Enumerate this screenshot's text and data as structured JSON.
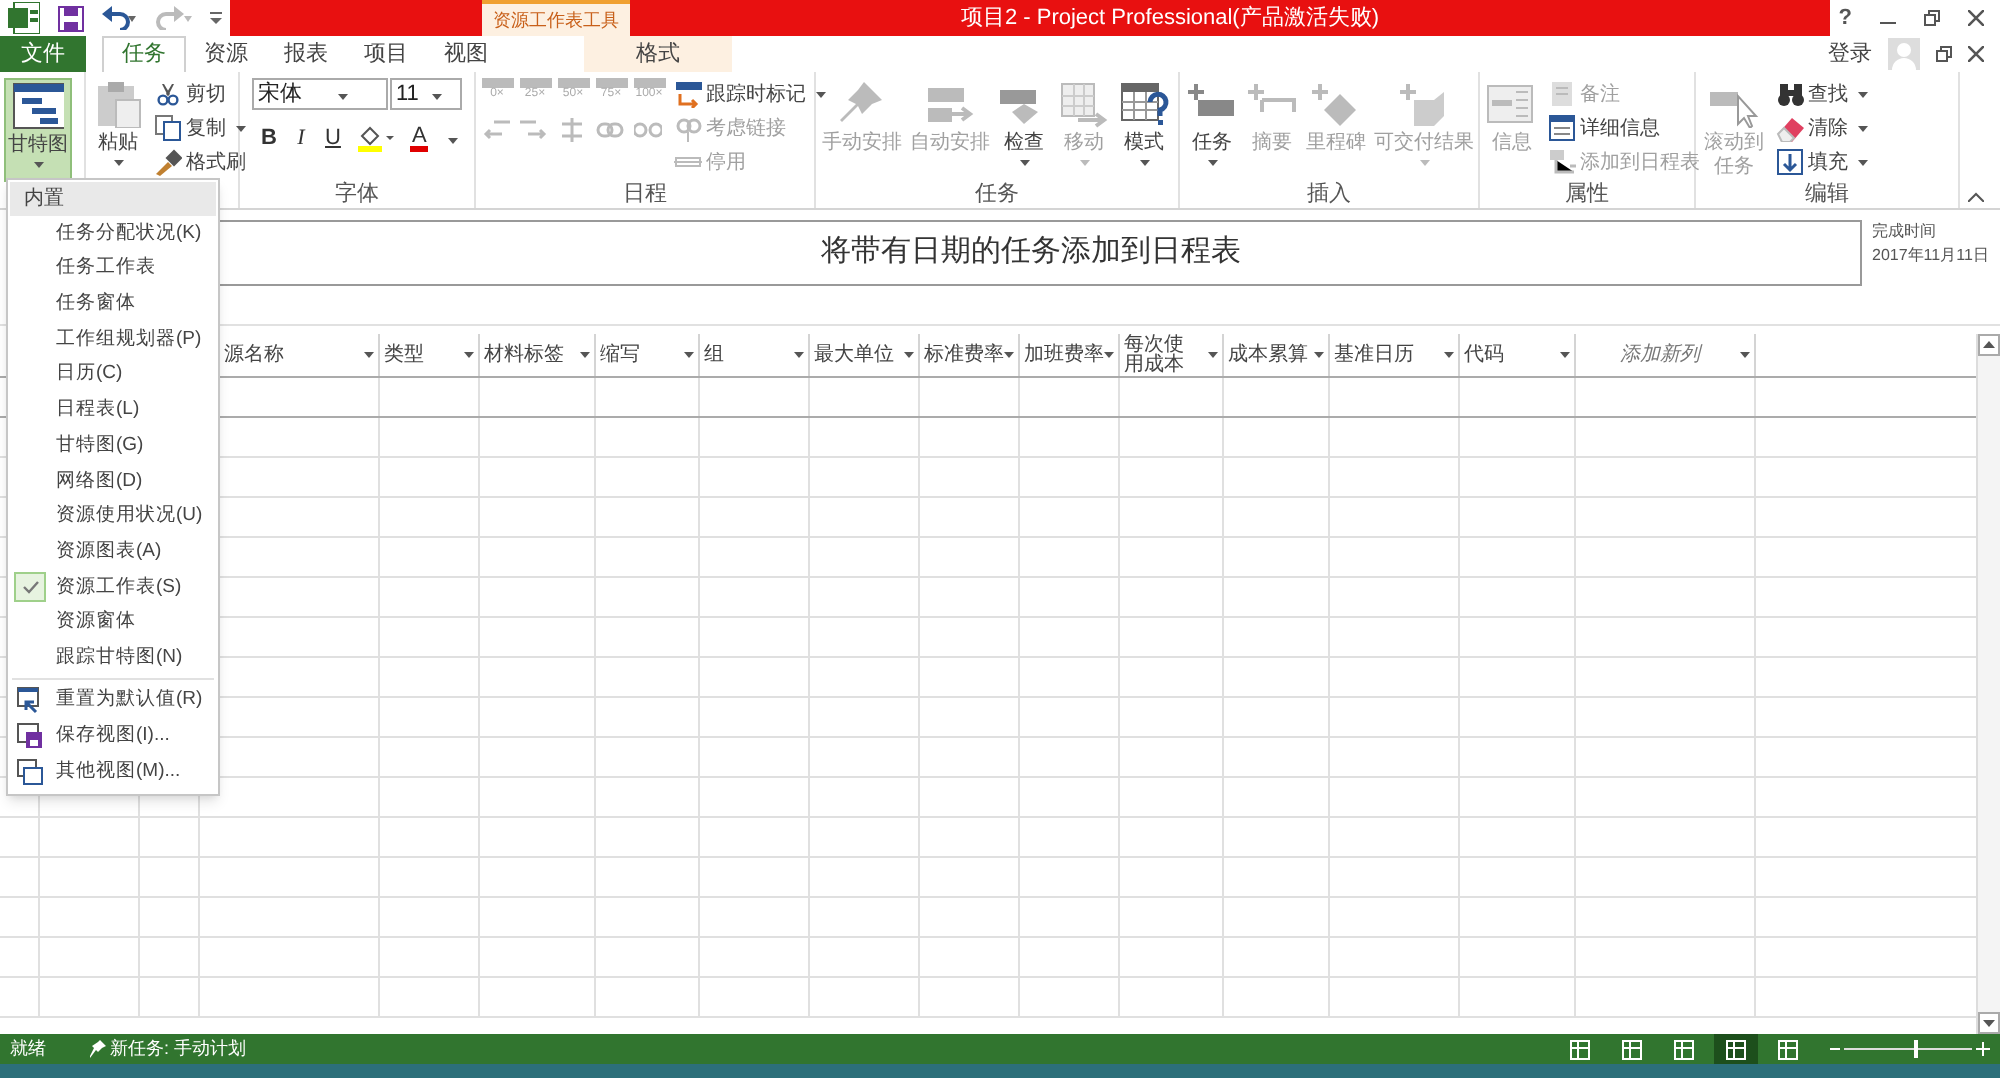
{
  "title_bar": {
    "context_label": "资源工作表工具",
    "title": "项目2 -  Project Professional(产品激活失败)",
    "help": "?"
  },
  "tabs": [
    {
      "label": "文件",
      "kind": "file",
      "selected": false
    },
    {
      "label": "任务",
      "kind": "tab",
      "selected": true
    },
    {
      "label": "资源",
      "kind": "tab",
      "selected": false
    },
    {
      "label": "报表",
      "kind": "tab",
      "selected": false
    },
    {
      "label": "项目",
      "kind": "tab",
      "selected": false
    },
    {
      "label": "视图",
      "kind": "tab",
      "selected": false
    },
    {
      "label": "格式",
      "kind": "context",
      "selected": false
    }
  ],
  "account": {
    "sign_in": "登录"
  },
  "ribbon": {
    "groups": [
      {
        "items": [
          {
            "kind": "large",
            "label": "甘特图",
            "caret": true,
            "selected": true,
            "disabled": false
          }
        ]
      },
      {
        "items": [
          {
            "kind": "large",
            "label": "粘贴",
            "caret": true,
            "selected": false,
            "disabled": false
          },
          {
            "kind": "stack",
            "items": [
              {
                "label": "剪切",
                "caret": false,
                "disabled": false
              },
              {
                "label": "复制",
                "caret": true,
                "disabled": false
              },
              {
                "label": "格式刷",
                "caret": false,
                "disabled": false
              }
            ]
          }
        ]
      },
      {
        "label": "字体",
        "items": [
          {
            "kind": "font",
            "font_name": "宋体",
            "font_size": "11",
            "styles": [
              "B",
              "I",
              "U"
            ],
            "font_color_glyph": "A"
          }
        ]
      },
      {
        "label": "日程",
        "items": [
          {
            "kind": "percent",
            "labels": [
              "0×",
              "25×",
              "50×",
              "75×",
              "100×"
            ]
          },
          {
            "kind": "stack",
            "items": [
              {
                "label": "跟踪时标记",
                "caret": true,
                "disabled": false
              },
              {
                "label": "考虑链接",
                "caret": false,
                "disabled": true
              },
              {
                "label": "停用",
                "caret": false,
                "disabled": true
              }
            ]
          }
        ]
      },
      {
        "label": "任务",
        "items": [
          {
            "kind": "large",
            "label": "手动安排",
            "caret": false,
            "selected": false,
            "disabled": true
          },
          {
            "kind": "large",
            "label": "自动安排",
            "caret": false,
            "selected": false,
            "disabled": true
          },
          {
            "kind": "large",
            "label": "检查",
            "caret": true,
            "selected": false,
            "disabled": false
          },
          {
            "kind": "large",
            "label": "移动",
            "caret": true,
            "selected": false,
            "disabled": true
          },
          {
            "kind": "large",
            "label": "模式",
            "caret": true,
            "selected": false,
            "disabled": false
          }
        ]
      },
      {
        "label": "插入",
        "items": [
          {
            "kind": "large",
            "label": "任务",
            "caret": true,
            "selected": false,
            "disabled": false
          },
          {
            "kind": "large",
            "label": "摘要",
            "caret": false,
            "selected": false,
            "disabled": true
          },
          {
            "kind": "large",
            "label": "里程碑",
            "caret": false,
            "selected": false,
            "disabled": true
          },
          {
            "kind": "large",
            "label": "可交付结果",
            "caret": true,
            "selected": false,
            "disabled": true
          }
        ]
      },
      {
        "label": "属性",
        "items": [
          {
            "kind": "large",
            "label": "信息",
            "caret": false,
            "selected": false,
            "disabled": true
          },
          {
            "kind": "stack",
            "items": [
              {
                "label": "备注",
                "caret": false,
                "disabled": true
              },
              {
                "label": "详细信息",
                "caret": false,
                "disabled": false
              },
              {
                "label": "添加到日程表",
                "caret": false,
                "disabled": true
              }
            ]
          }
        ]
      },
      {
        "label": "编辑",
        "items": [
          {
            "kind": "large",
            "label": "滚动到任务",
            "caret": false,
            "selected": false,
            "disabled": true,
            "two_line": true
          },
          {
            "kind": "stack",
            "items": [
              {
                "label": "查找",
                "caret": true,
                "disabled": false
              },
              {
                "label": "清除",
                "caret": true,
                "disabled": false
              },
              {
                "label": "填充",
                "caret": true,
                "disabled": false
              }
            ]
          }
        ]
      }
    ]
  },
  "timeline": {
    "prompt": "将带有日期的任务添加到日程表",
    "finish_label": "完成时间",
    "finish_date": "2017年11月11日"
  },
  "table": {
    "columns": [
      {
        "label": "源名称",
        "kind": "field"
      },
      {
        "label": "类型",
        "kind": "field"
      },
      {
        "label": "材料标签",
        "kind": "field"
      },
      {
        "label": "缩写",
        "kind": "field"
      },
      {
        "label": "组",
        "kind": "field"
      },
      {
        "label": "最大单位",
        "kind": "field"
      },
      {
        "label": "标准费率",
        "kind": "field"
      },
      {
        "label": "加班费率",
        "kind": "field"
      },
      {
        "label": "每次使用成本",
        "kind": "field"
      },
      {
        "label": "成本累算",
        "kind": "field"
      },
      {
        "label": "基准日历",
        "kind": "field"
      },
      {
        "label": "代码",
        "kind": "field"
      },
      {
        "label": "添加新列",
        "kind": "add"
      }
    ]
  },
  "view_menu": {
    "header": "内置",
    "items": [
      {
        "label": "任务分配状况(K)",
        "checked": false
      },
      {
        "label": "任务工作表",
        "checked": false
      },
      {
        "label": "任务窗体",
        "checked": false
      },
      {
        "label": "工作组规划器(P)",
        "checked": false
      },
      {
        "label": "日历(C)",
        "checked": false
      },
      {
        "label": "日程表(L)",
        "checked": false
      },
      {
        "label": "甘特图(G)",
        "checked": false
      },
      {
        "label": "网络图(D)",
        "checked": false
      },
      {
        "label": "资源使用状况(U)",
        "checked": false
      },
      {
        "label": "资源图表(A)",
        "checked": false
      },
      {
        "label": "资源工作表(S)",
        "checked": true
      },
      {
        "label": "资源窗体",
        "checked": false
      },
      {
        "label": "跟踪甘特图(N)",
        "checked": false
      }
    ],
    "actions": [
      "重置为默认值(R)",
      "保存视图(I)...",
      "其他视图(M)..."
    ]
  },
  "status_bar": {
    "ready": "就绪",
    "new_task": "新任务: 手动计划",
    "views": [
      {
        "selected": false
      },
      {
        "selected": false
      },
      {
        "selected": false
      },
      {
        "selected": true
      },
      {
        "selected": false
      }
    ],
    "zoom": {
      "level": 0.55
    }
  }
}
